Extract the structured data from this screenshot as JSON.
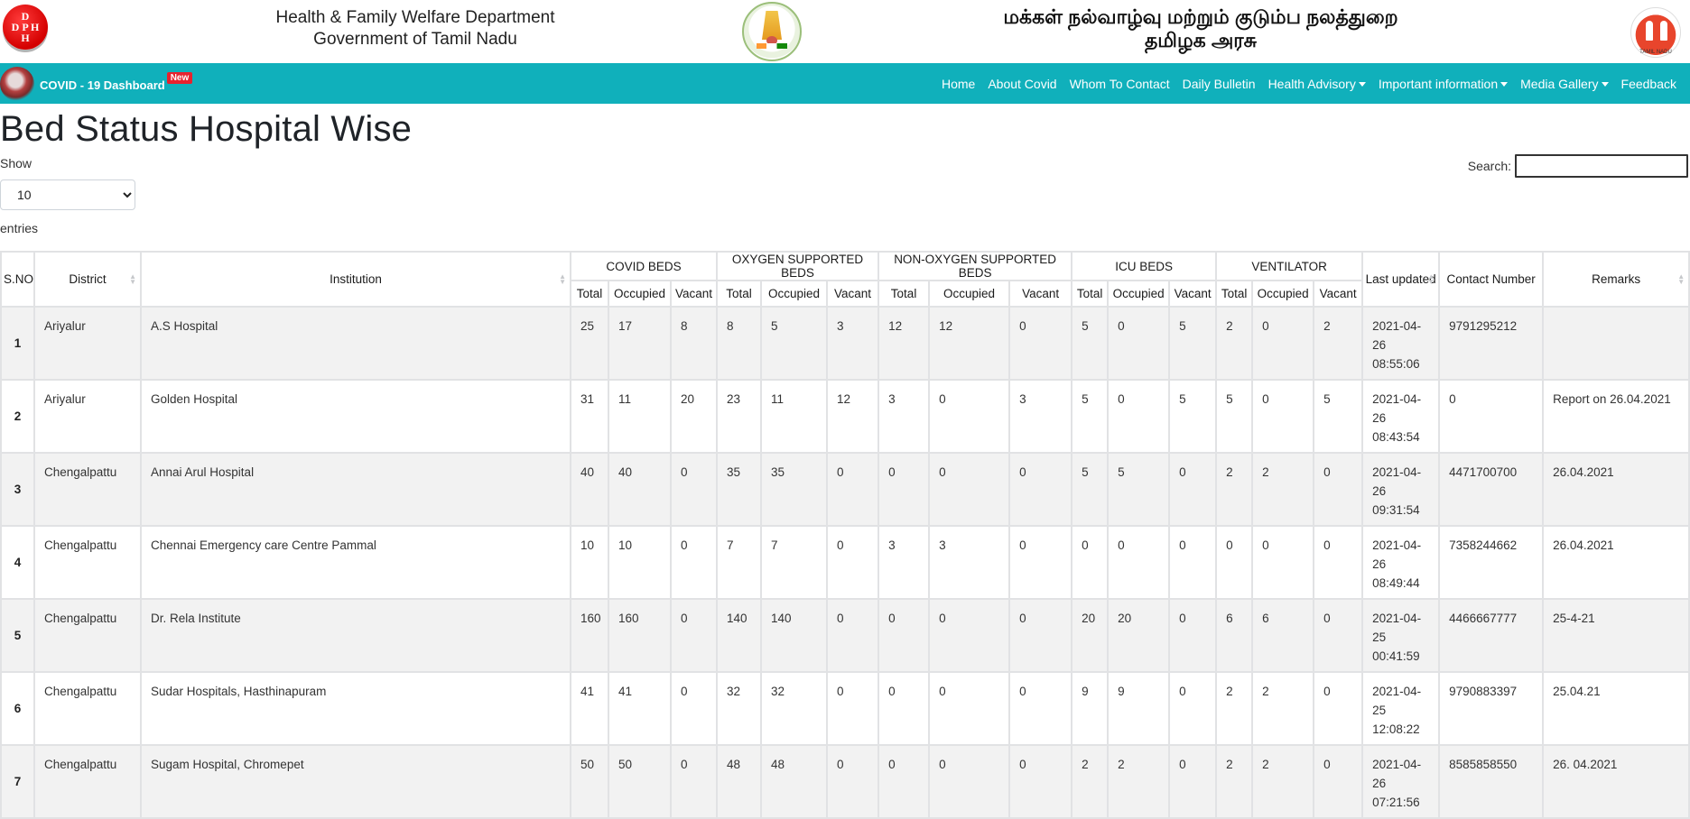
{
  "header": {
    "dph_logo_text": [
      "D",
      "D P H",
      "H"
    ],
    "dept_en_line1": "Health & Family Welfare Department",
    "dept_en_line2": "Government of Tamil Nadu",
    "dept_ta_line1": "மக்கள் நல்வாழ்வு மற்றும் குடும்ப நலத்துறை",
    "dept_ta_line2": "தமிழக அரசு",
    "nhm_logo_caption": "TAMIL NADU"
  },
  "nav": {
    "brand": "COVID - 19 Dashboard",
    "badge": "New",
    "links": [
      {
        "label": "Home",
        "dropdown": false
      },
      {
        "label": "About Covid",
        "dropdown": false
      },
      {
        "label": "Whom To Contact",
        "dropdown": false
      },
      {
        "label": "Daily Bulletin",
        "dropdown": false
      },
      {
        "label": "Health Advisory",
        "dropdown": true
      },
      {
        "label": "Important information",
        "dropdown": true
      },
      {
        "label": "Media Gallery",
        "dropdown": true
      },
      {
        "label": "Feedback",
        "dropdown": false
      }
    ],
    "colors": {
      "bar": "#10b0bb",
      "badge": "#e7222e"
    }
  },
  "page": {
    "title": "Bed Status Hospital Wise",
    "show_label": "Show",
    "page_length": "10",
    "entries_label": "entries",
    "search_label": "Search:",
    "search_value": ""
  },
  "table": {
    "headers": {
      "sno": "S.NO",
      "district": "District",
      "institution": "Institution",
      "groups": [
        "COVID BEDS",
        "OXYGEN SUPPORTED BEDS",
        "NON-OXYGEN SUPPORTED BEDS",
        "ICU BEDS",
        "VENTILATOR"
      ],
      "sub": [
        "Total",
        "Occupied",
        "Vacant"
      ],
      "last_updated": "Last updated",
      "contact": "Contact Number",
      "remarks": "Remarks"
    },
    "rows": [
      {
        "sno": "1",
        "district": "Ariyalur",
        "institution": "A.S Hospital",
        "covid": [
          "25",
          "17",
          "8"
        ],
        "oxygen": [
          "8",
          "5",
          "3"
        ],
        "non_oxygen": [
          "12",
          "12",
          "0"
        ],
        "icu": [
          "5",
          "0",
          "5"
        ],
        "ventilator": [
          "2",
          "0",
          "2"
        ],
        "updated": [
          "2021-04-",
          "26",
          "08:55:06"
        ],
        "contact": "9791295212",
        "remarks": ""
      },
      {
        "sno": "2",
        "district": "Ariyalur",
        "institution": "Golden Hospital",
        "covid": [
          "31",
          "11",
          "20"
        ],
        "oxygen": [
          "23",
          "11",
          "12"
        ],
        "non_oxygen": [
          "3",
          "0",
          "3"
        ],
        "icu": [
          "5",
          "0",
          "5"
        ],
        "ventilator": [
          "5",
          "0",
          "5"
        ],
        "updated": [
          "2021-04-",
          "26",
          "08:43:54"
        ],
        "contact": "0",
        "remarks": "Report on 26.04.2021"
      },
      {
        "sno": "3",
        "district": "Chengalpattu",
        "institution": "Annai Arul Hospital",
        "covid": [
          "40",
          "40",
          "0"
        ],
        "oxygen": [
          "35",
          "35",
          "0"
        ],
        "non_oxygen": [
          "0",
          "0",
          "0"
        ],
        "icu": [
          "5",
          "5",
          "0"
        ],
        "ventilator": [
          "2",
          "2",
          "0"
        ],
        "updated": [
          "2021-04-",
          "26",
          "09:31:54"
        ],
        "contact": "4471700700",
        "remarks": "26.04.2021"
      },
      {
        "sno": "4",
        "district": "Chengalpattu",
        "institution": "Chennai Emergency care Centre Pammal",
        "covid": [
          "10",
          "10",
          "0"
        ],
        "oxygen": [
          "7",
          "7",
          "0"
        ],
        "non_oxygen": [
          "3",
          "3",
          "0"
        ],
        "icu": [
          "0",
          "0",
          "0"
        ],
        "ventilator": [
          "0",
          "0",
          "0"
        ],
        "updated": [
          "2021-04-",
          "26",
          "08:49:44"
        ],
        "contact": "7358244662",
        "remarks": "26.04.2021"
      },
      {
        "sno": "5",
        "district": "Chengalpattu",
        "institution": "Dr. Rela Institute",
        "covid": [
          "160",
          "160",
          "0"
        ],
        "oxygen": [
          "140",
          "140",
          "0"
        ],
        "non_oxygen": [
          "0",
          "0",
          "0"
        ],
        "icu": [
          "20",
          "20",
          "0"
        ],
        "ventilator": [
          "6",
          "6",
          "0"
        ],
        "updated": [
          "2021-04-",
          "25",
          "00:41:59"
        ],
        "contact": "4466667777",
        "remarks": "25-4-21"
      },
      {
        "sno": "6",
        "district": "Chengalpattu",
        "institution": "Sudar Hospitals, Hasthinapuram",
        "covid": [
          "41",
          "41",
          "0"
        ],
        "oxygen": [
          "32",
          "32",
          "0"
        ],
        "non_oxygen": [
          "0",
          "0",
          "0"
        ],
        "icu": [
          "9",
          "9",
          "0"
        ],
        "ventilator": [
          "2",
          "2",
          "0"
        ],
        "updated": [
          "2021-04-",
          "25",
          "12:08:22"
        ],
        "contact": "9790883397",
        "remarks": "25.04.21"
      },
      {
        "sno": "7",
        "district": "Chengalpattu",
        "institution": "Sugam Hospital, Chromepet",
        "covid": [
          "50",
          "50",
          "0"
        ],
        "oxygen": [
          "48",
          "48",
          "0"
        ],
        "non_oxygen": [
          "0",
          "0",
          "0"
        ],
        "icu": [
          "2",
          "2",
          "0"
        ],
        "ventilator": [
          "2",
          "2",
          "0"
        ],
        "updated": [
          "2021-04-",
          "26",
          "07:21:56"
        ],
        "contact": "8585858550",
        "remarks": "26. 04.2021"
      }
    ]
  }
}
